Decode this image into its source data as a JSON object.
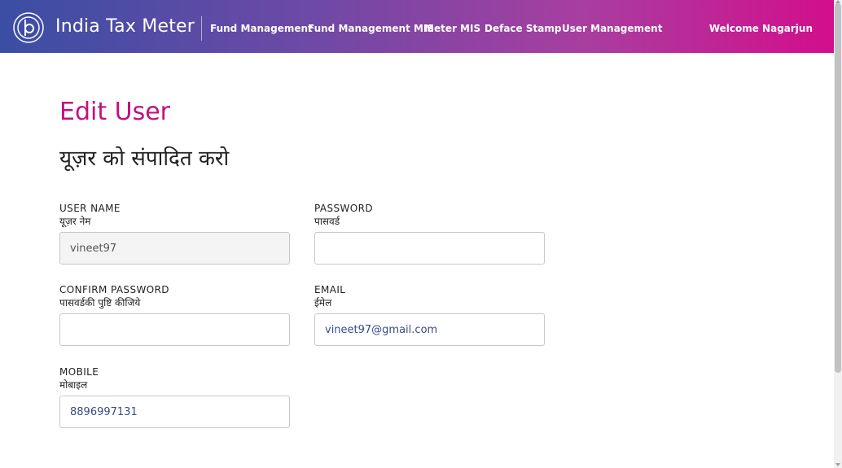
{
  "header": {
    "brand": "India Tax Meter",
    "nav": [
      {
        "label": "Fund Management"
      },
      {
        "label": "Fund Management MIS"
      },
      {
        "label": "Meter MIS"
      },
      {
        "label": "Deface Stamp"
      },
      {
        "label": "User Management"
      }
    ],
    "welcome": "Welcome Nagarjun",
    "logo_icon": "pb-logo-icon",
    "gradient_colors": [
      "#3a4ea4",
      "#d30e8c"
    ]
  },
  "page": {
    "title": "Edit User",
    "subtitle": "यूज़र को संपादित करो",
    "title_color": "#c0127f"
  },
  "form": {
    "username": {
      "label_en": "USER NAME",
      "label_hi": "यूज़र नेम",
      "value": "vineet97",
      "disabled": true
    },
    "password": {
      "label_en": "PASSWORD",
      "label_hi": "पासवर्ड",
      "value": ""
    },
    "confirm_password": {
      "label_en": "CONFIRM PASSWORD",
      "label_hi": "पासवर्डकी पुष्टि कीजिये",
      "value": ""
    },
    "email": {
      "label_en": "EMAIL",
      "label_hi": "ईमेल",
      "value": "vineet97@gmail.com"
    },
    "mobile": {
      "label_en": "MOBILE",
      "label_hi": "मोबाइल",
      "value": "8896997131"
    }
  }
}
